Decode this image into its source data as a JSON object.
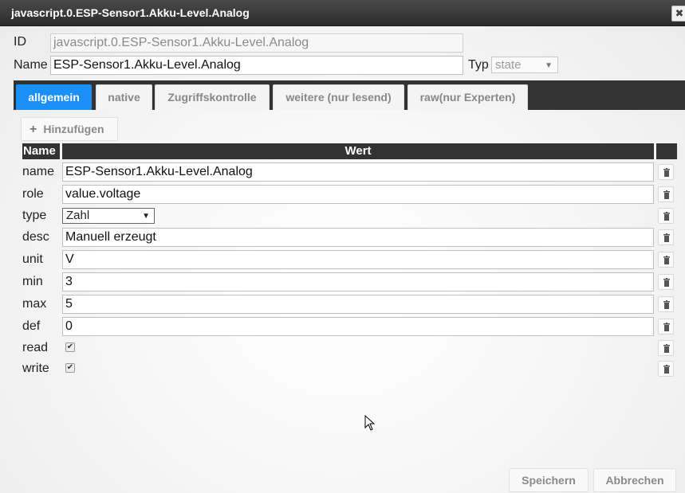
{
  "dialog": {
    "title": "javascript.0.ESP-Sensor1.Akku-Level.Analog",
    "close_glyph": "✖"
  },
  "header": {
    "id_label": "ID",
    "id_value": "javascript.0.ESP-Sensor1.Akku-Level.Analog",
    "name_label": "Name",
    "name_value": "ESP-Sensor1.Akku-Level.Analog",
    "typ_label": "Typ",
    "typ_value": "state"
  },
  "tabs": [
    {
      "label": "allgemein",
      "active": true
    },
    {
      "label": "native",
      "active": false
    },
    {
      "label": "Zugriffskontrolle",
      "active": false
    },
    {
      "label": "weitere (nur lesend)",
      "active": false
    },
    {
      "label": "raw(nur Experten)",
      "active": false
    }
  ],
  "add_button": {
    "label": "Hinzufügen",
    "icon": "plus-icon"
  },
  "table": {
    "headers": {
      "name": "Name",
      "value": "Wert"
    },
    "rows": [
      {
        "name": "name",
        "value": "ESP-Sensor1.Akku-Level.Analog"
      },
      {
        "name": "role",
        "value": "value.voltage"
      },
      {
        "name": "type",
        "value": "Zahl"
      },
      {
        "name": "desc",
        "value": "Manuell erzeugt"
      },
      {
        "name": "unit",
        "value": "V"
      },
      {
        "name": "min",
        "value": "3"
      },
      {
        "name": "max",
        "value": "5"
      },
      {
        "name": "def",
        "value": "0"
      },
      {
        "name": "read",
        "checked": true
      },
      {
        "name": "write",
        "checked": true
      }
    ]
  },
  "footer": {
    "save_label": "Speichern",
    "cancel_label": "Abbrechen"
  },
  "colors": {
    "accent": "#1a8ff5",
    "titlebar": "#333333"
  }
}
